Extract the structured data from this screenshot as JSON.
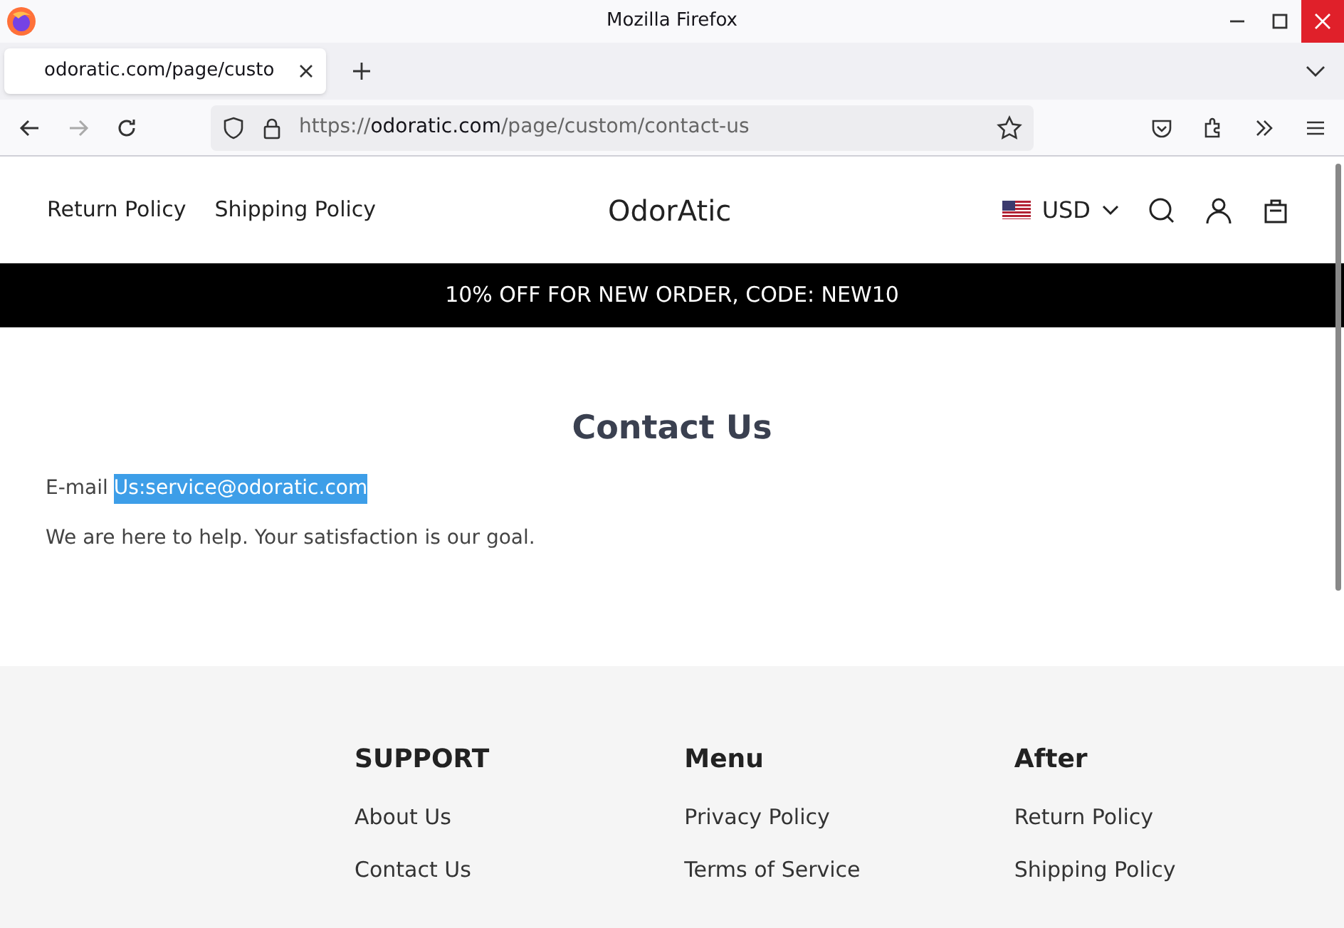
{
  "window": {
    "title": "Mozilla Firefox"
  },
  "tabs": [
    {
      "label": "odoratic.com/page/custo",
      "selected": true
    }
  ],
  "address_bar": {
    "scheme": "https://",
    "domain": "odoratic.com",
    "path": "/page/custom/contact-us"
  },
  "site_header": {
    "nav": [
      "Return Policy",
      "Shipping Policy"
    ],
    "logo": "OdorAtic",
    "currency": "USD"
  },
  "announcement": "10% OFF FOR NEW ORDER, CODE: NEW10",
  "contact": {
    "title": "Contact Us",
    "email_label": "E-mail",
    "email": "Us:service@odoratic.com",
    "email_selected": true,
    "message": "We are here to help. Your satisfaction is our goal."
  },
  "footer": {
    "columns": [
      {
        "heading": "SUPPORT",
        "links": [
          "About Us",
          "Contact Us"
        ]
      },
      {
        "heading": "Menu",
        "links": [
          "Privacy Policy",
          "Terms of Service"
        ]
      },
      {
        "heading": "After",
        "links": [
          "Return Policy",
          "Shipping Policy"
        ]
      }
    ]
  }
}
